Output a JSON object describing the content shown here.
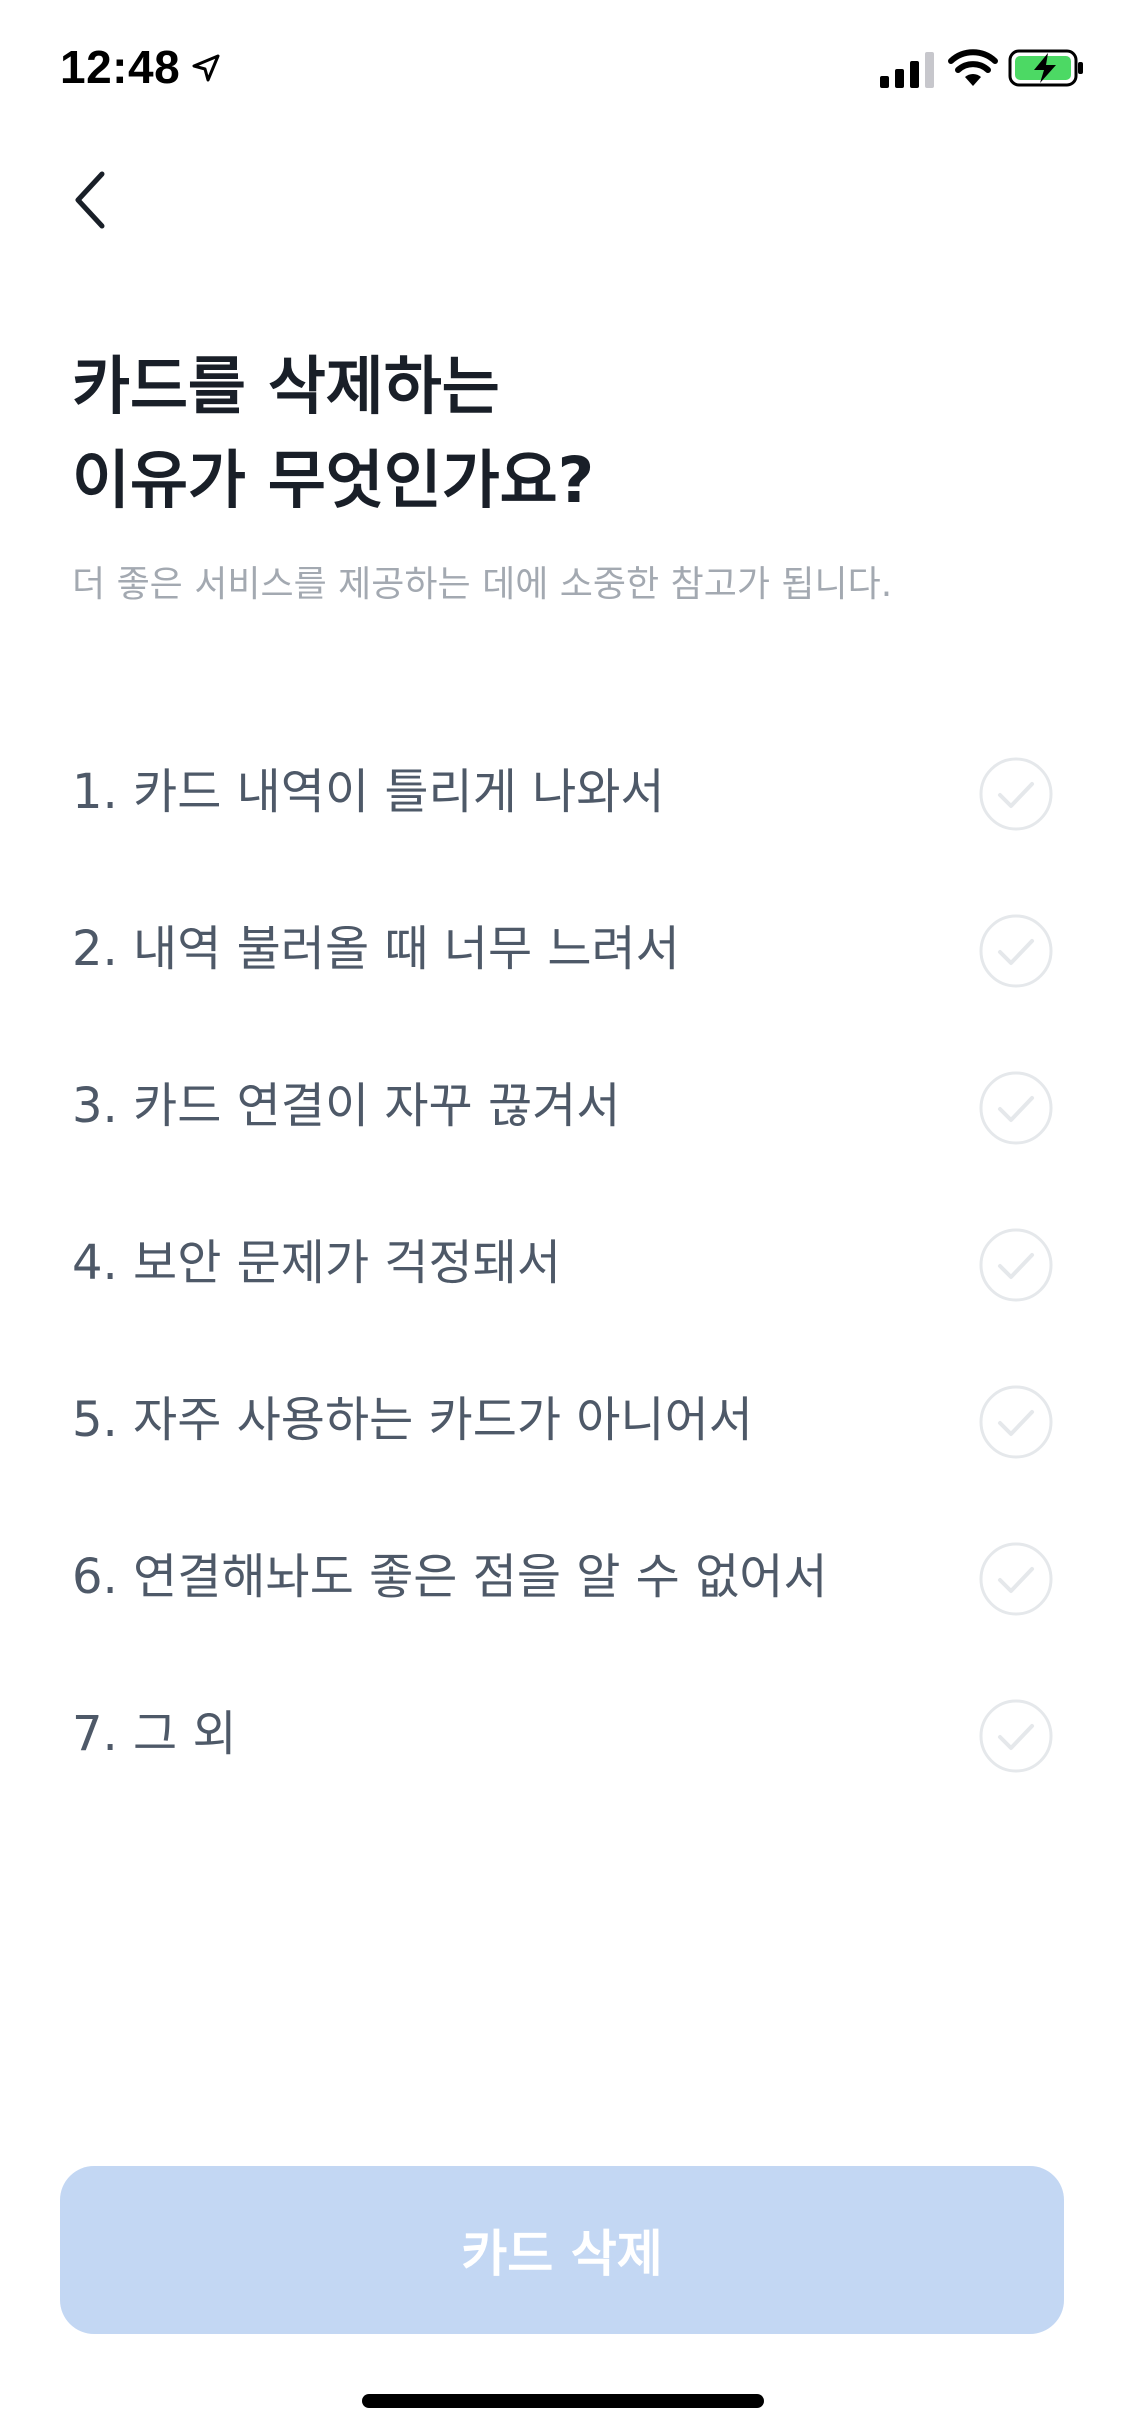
{
  "status_bar": {
    "time": "12:48"
  },
  "header": {
    "title_line1": "카드를 삭제하는",
    "title_line2": "이유가 무엇인가요?",
    "subtitle": "더 좋은 서비스를 제공하는 데에 소중한 참고가 됩니다."
  },
  "options": [
    {
      "label": "1. 카드 내역이 틀리게 나와서",
      "selected": false
    },
    {
      "label": "2. 내역 불러올 때 너무 느려서",
      "selected": false
    },
    {
      "label": "3. 카드 연결이 자꾸 끊겨서",
      "selected": false
    },
    {
      "label": "4. 보안 문제가 걱정돼서",
      "selected": false
    },
    {
      "label": "5. 자주 사용하는 카드가 아니어서",
      "selected": false
    },
    {
      "label": "6. 연결해놔도 좋은 점을 알 수 없어서",
      "selected": false
    },
    {
      "label": "7. 그 외",
      "selected": false
    }
  ],
  "footer": {
    "delete_label": "카드 삭제"
  },
  "colors": {
    "title": "#191f28",
    "option_text": "#4e5968",
    "subtitle": "#a3a9b1",
    "button_disabled": "#c3d7f3",
    "check_inactive": "#e5e8eb",
    "battery_green": "#4cd964"
  },
  "icons": {
    "back": "chevron-left-icon",
    "check": "check-circle-icon",
    "location": "location-arrow-icon",
    "signal": "cellular-signal-icon",
    "wifi": "wifi-icon",
    "battery": "battery-charging-icon"
  }
}
